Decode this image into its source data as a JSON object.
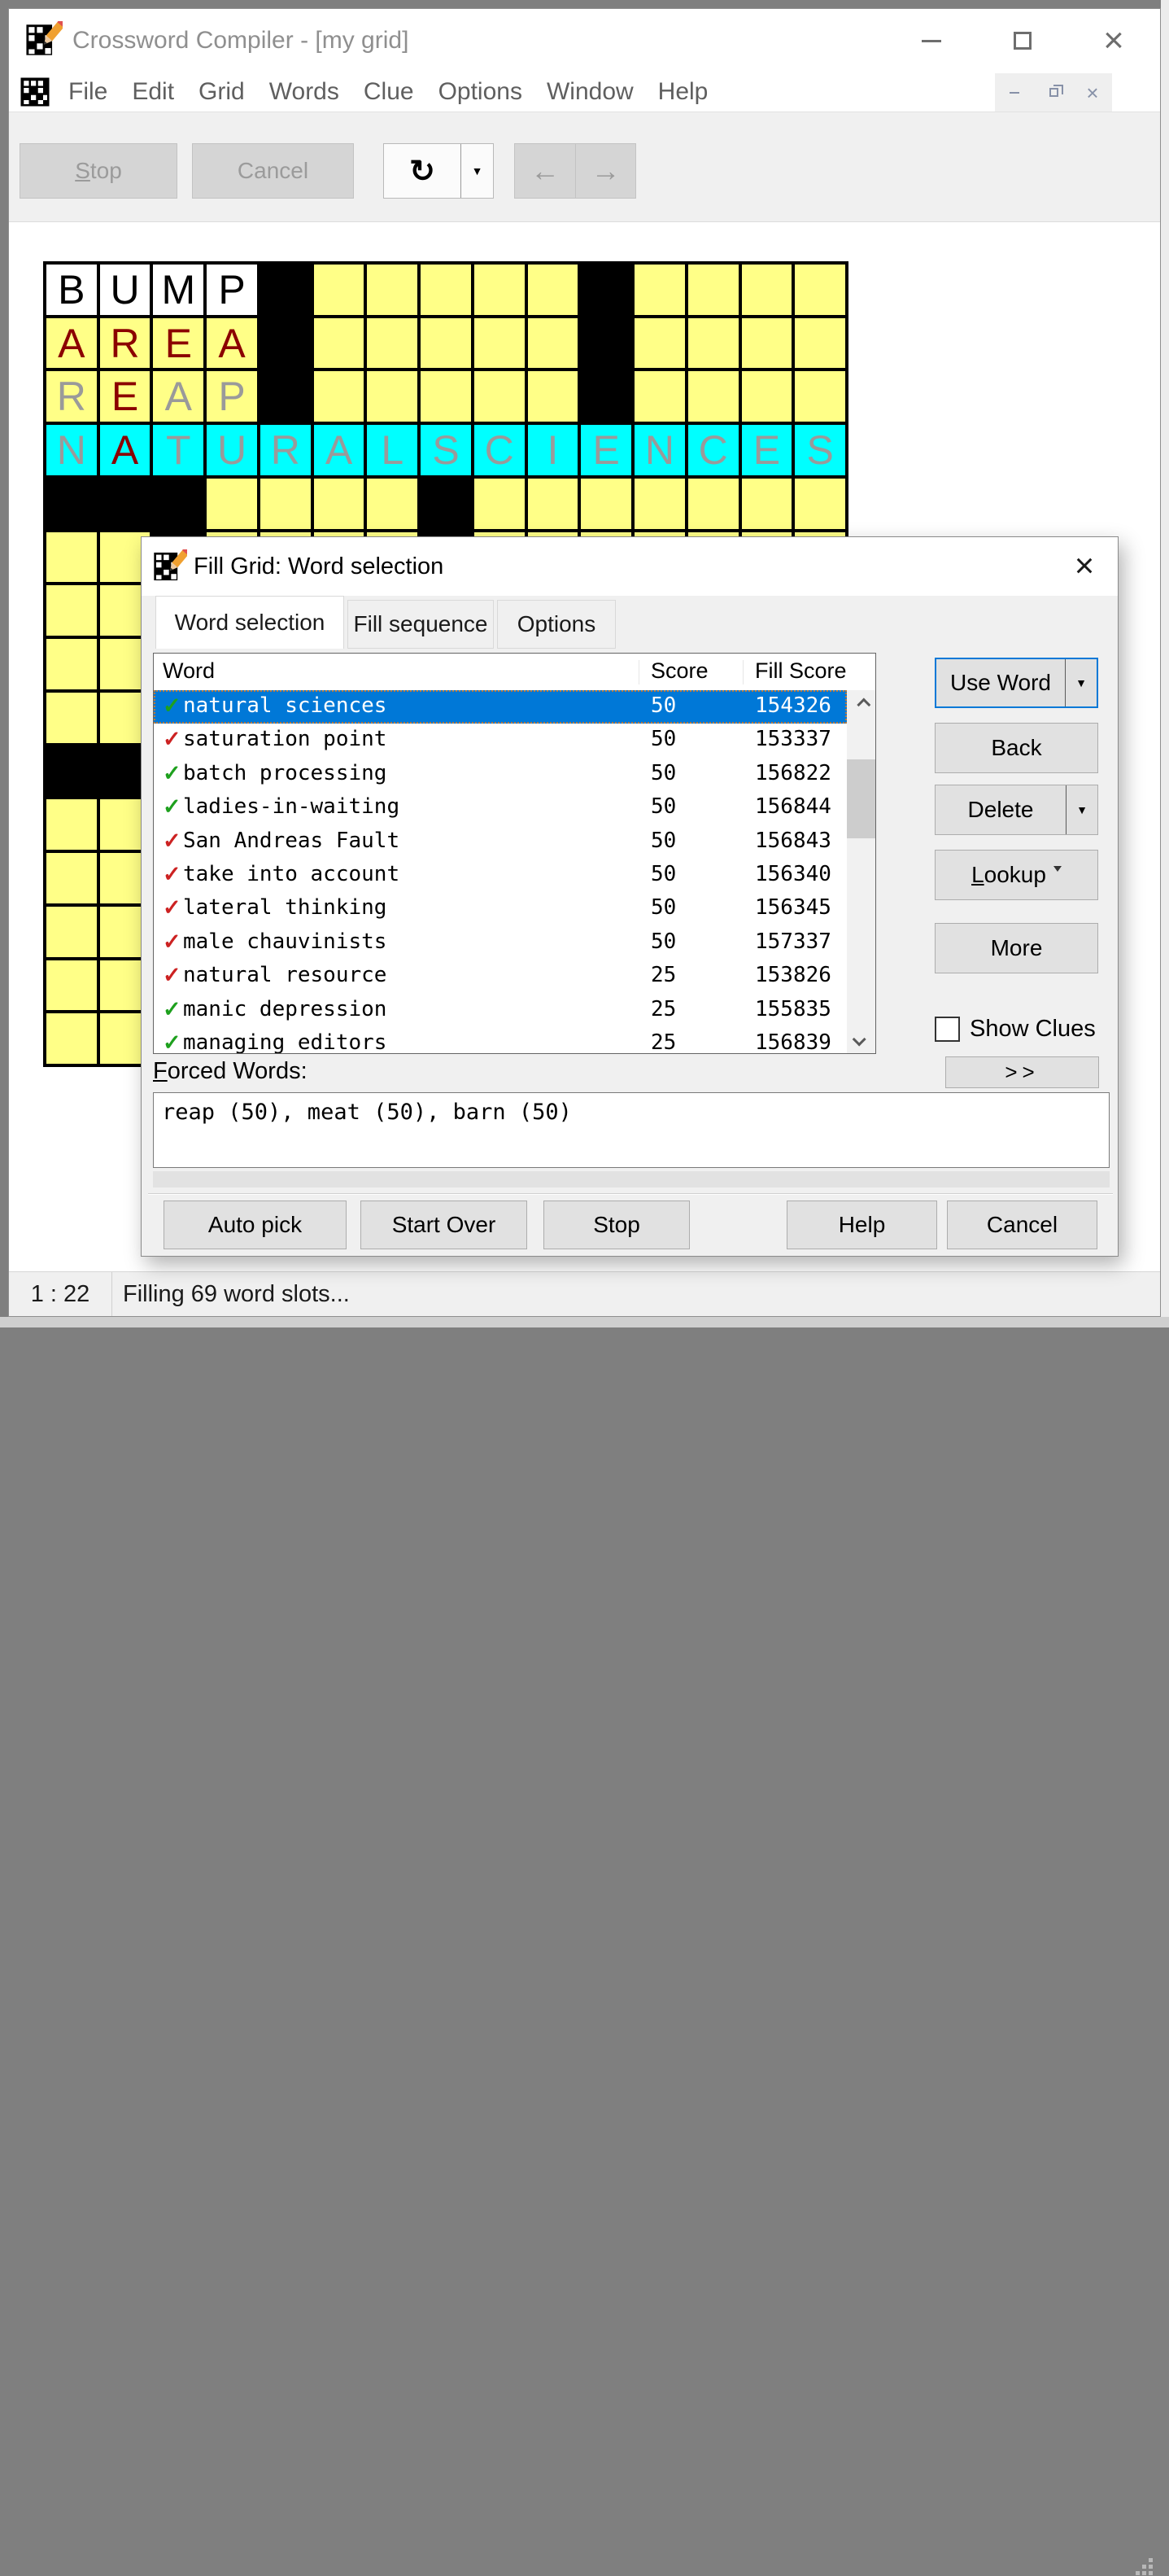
{
  "window": {
    "title": "Crossword Compiler - [my grid]"
  },
  "menu": {
    "items": [
      "File",
      "Edit",
      "Grid",
      "Words",
      "Clue",
      "Options",
      "Window",
      "Help"
    ]
  },
  "toolbar": {
    "stop": "Stop",
    "cancel": "Cancel",
    "refresh_icon": "↻",
    "back_arrow": "←",
    "forward_arrow": "→",
    "dropdown_icon": "▼"
  },
  "grid": {
    "rows": [
      [
        "W:B:k",
        "W:U:k",
        "W:M:k",
        "W:P:k",
        "K",
        "Y",
        "Y",
        "Y",
        "Y",
        "Y",
        "K",
        "Y",
        "Y",
        "Y",
        "Y"
      ],
      [
        "Y:A:r",
        "Y:R:r",
        "Y:E:r",
        "Y:A:r",
        "K",
        "Y",
        "Y",
        "Y",
        "Y",
        "Y",
        "K",
        "Y",
        "Y",
        "Y",
        "Y"
      ],
      [
        "Y:R:g",
        "Y:E:r",
        "Y:A:g",
        "Y:P:g",
        "K",
        "Y",
        "Y",
        "Y",
        "Y",
        "Y",
        "K",
        "Y",
        "Y",
        "Y",
        "Y"
      ],
      [
        "C:N:g",
        "C:A:r",
        "C:T:g",
        "C:U:g",
        "C:R:g",
        "C:A:g",
        "C:L:g",
        "C:S:g",
        "C:C:g",
        "C:I:g",
        "C:E:g",
        "C:N:g",
        "C:C:g",
        "C:E:g",
        "C:S:g"
      ],
      [
        "K",
        "K",
        "K",
        "Y",
        "Y",
        "Y",
        "Y",
        "K",
        "Y",
        "Y",
        "Y",
        "Y",
        "Y",
        "Y",
        "Y"
      ],
      [
        "Y",
        "Y",
        "K",
        "Y",
        "Y",
        "Y",
        "Y",
        "K",
        "Y",
        "Y",
        "Y",
        "Y",
        "Y",
        "Y",
        "Y"
      ],
      [
        "Y",
        "Y",
        "Y",
        "Y",
        "Y",
        "Y",
        "Y",
        "Y",
        "Y",
        "Y",
        "Y",
        "Y",
        "Y",
        "Y",
        "Y"
      ],
      [
        "Y",
        "Y",
        "Y",
        "Y",
        "Y",
        "Y",
        "Y",
        "Y",
        "Y",
        "Y",
        "Y",
        "Y",
        "Y",
        "Y",
        "Y"
      ],
      [
        "Y",
        "Y",
        "Y",
        "Y",
        "Y",
        "Y",
        "Y",
        "Y",
        "Y",
        "Y",
        "Y",
        "Y",
        "Y",
        "Y",
        "Y"
      ],
      [
        "K",
        "K",
        "Y",
        "Y",
        "Y",
        "Y",
        "Y",
        "Y",
        "Y",
        "Y",
        "Y",
        "Y",
        "Y",
        "Y",
        "Y"
      ],
      [
        "Y",
        "Y",
        "Y",
        "Y",
        "Y",
        "Y",
        "Y",
        "Y",
        "Y",
        "Y",
        "Y",
        "Y",
        "Y",
        "Y",
        "Y"
      ],
      [
        "Y",
        "Y",
        "Y",
        "Y",
        "Y",
        "Y",
        "Y",
        "Y",
        "Y",
        "Y",
        "Y",
        "Y",
        "Y",
        "Y",
        "Y"
      ],
      [
        "Y",
        "Y",
        "Y",
        "Y",
        "Y",
        "Y",
        "Y",
        "Y",
        "Y",
        "Y",
        "Y",
        "Y",
        "Y",
        "Y",
        "Y"
      ],
      [
        "Y",
        "Y",
        "Y",
        "Y",
        "Y",
        "Y",
        "Y",
        "Y",
        "Y",
        "Y",
        "Y",
        "Y",
        "Y",
        "Y",
        "Y"
      ],
      [
        "Y",
        "Y",
        "Y",
        "Y",
        "Y",
        "Y",
        "Y",
        "Y",
        "Y",
        "Y",
        "Y",
        "Y",
        "Y",
        "Y",
        "Y"
      ]
    ]
  },
  "dialog": {
    "title": "Fill Grid: Word selection",
    "tabs": [
      {
        "label": "Word selection",
        "active": true
      },
      {
        "label": "Fill sequence",
        "active": false
      },
      {
        "label": "Options",
        "active": false
      }
    ],
    "list": {
      "headers": [
        "Word",
        "Score",
        "Fill Score"
      ],
      "rows": [
        {
          "check": "green",
          "word": "natural sciences",
          "score": "50",
          "fill": "154326",
          "selected": true
        },
        {
          "check": "red",
          "word": "saturation point",
          "score": "50",
          "fill": "153337"
        },
        {
          "check": "green",
          "word": "batch processing",
          "score": "50",
          "fill": "156822"
        },
        {
          "check": "green",
          "word": "ladies-in-waiting",
          "score": "50",
          "fill": "156844"
        },
        {
          "check": "red",
          "word": "San Andreas Fault",
          "score": "50",
          "fill": "156843"
        },
        {
          "check": "red",
          "word": "take into account",
          "score": "50",
          "fill": "156340"
        },
        {
          "check": "red",
          "word": "lateral thinking",
          "score": "50",
          "fill": "156345"
        },
        {
          "check": "red",
          "word": "male chauvinists",
          "score": "50",
          "fill": "157337"
        },
        {
          "check": "red",
          "word": "natural resource",
          "score": "25",
          "fill": "153826"
        },
        {
          "check": "green",
          "word": "manic depression",
          "score": "25",
          "fill": "155835"
        },
        {
          "check": "green",
          "word": "managing editors",
          "score": "25",
          "fill": "156839"
        }
      ]
    },
    "buttons": {
      "use_word": "Use Word",
      "back": "Back",
      "delete": "Delete",
      "lookup": "Lookup",
      "more": "More",
      "show_clues": "Show Clues",
      "expand": ">>"
    },
    "forced_label": "Forced Words:",
    "forced_text": "reap (50), meat (50), barn (50)",
    "bottom_buttons": [
      "Auto pick",
      "Start Over",
      "Stop",
      "Help",
      "Cancel"
    ]
  },
  "statusbar": {
    "left": "1 : 22",
    "message": "Filling 69 word slots..."
  },
  "colors": {
    "accent": "#0078d7",
    "cell_yellow": "#FFFF87",
    "cell_cyan": "#00FFFF",
    "letter_dark_red": "#8B0000",
    "letter_gray": "#9a9a9a",
    "check_green": "#1ea01e",
    "check_red": "#cc2222"
  }
}
